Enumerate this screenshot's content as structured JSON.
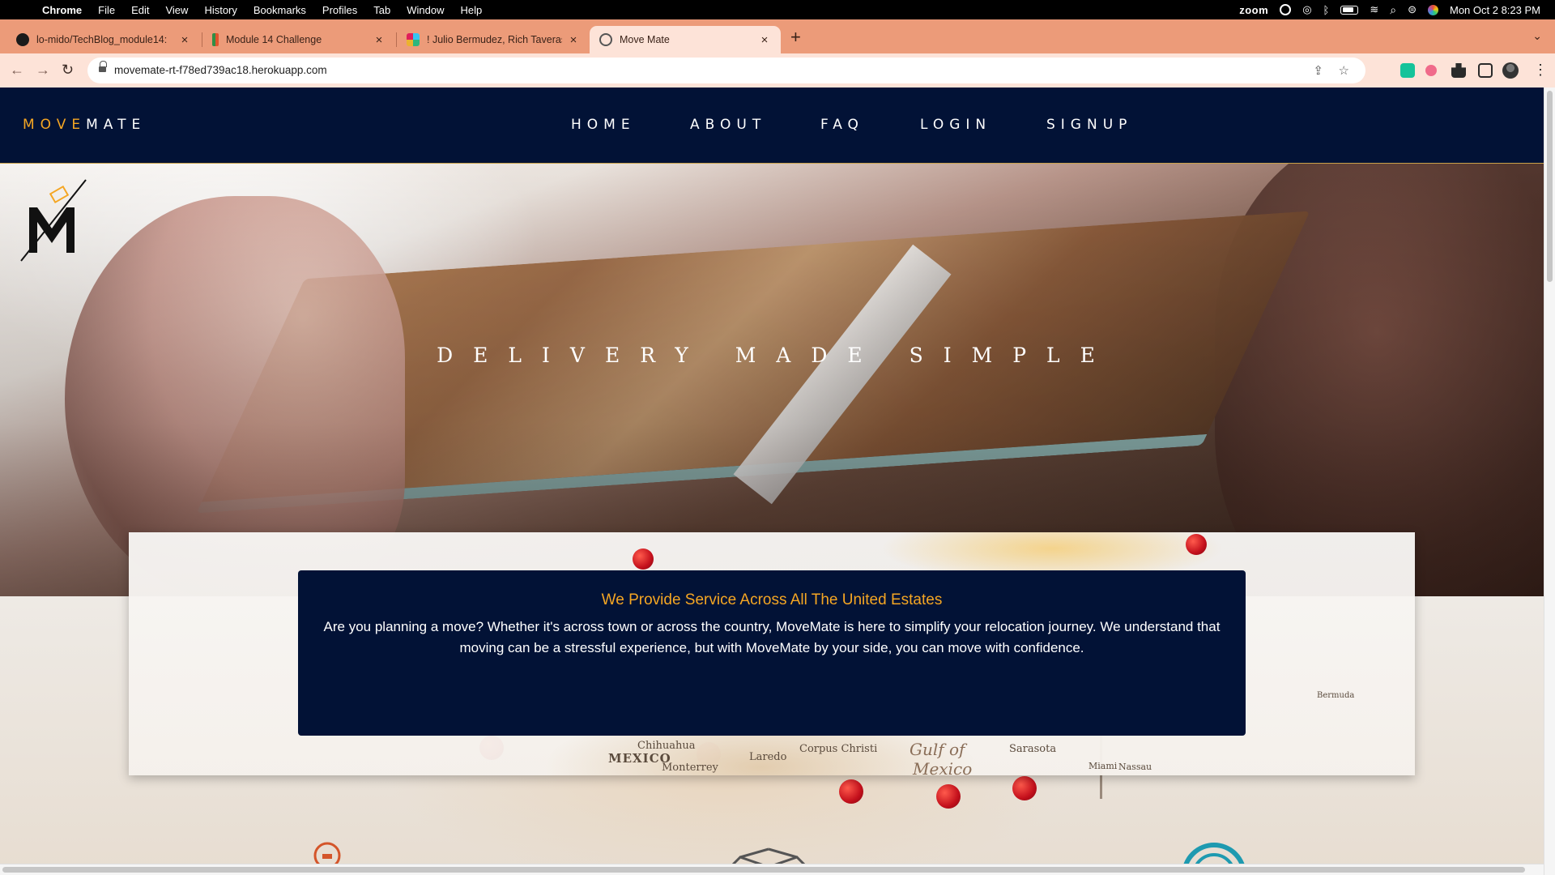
{
  "menubar": {
    "app": "Chrome",
    "items": [
      "File",
      "Edit",
      "View",
      "History",
      "Bookmarks",
      "Profiles",
      "Tab",
      "Window",
      "Help"
    ],
    "zoom_label": "zoom",
    "datetime": "Mon Oct 2  8:23 PM"
  },
  "tabs": [
    {
      "title": "lo-mido/TechBlog_module14:",
      "icon": "github-icon"
    },
    {
      "title": "Module 14 Challenge",
      "icon": "module-icon"
    },
    {
      "title": "! Julio Bermudez, Rich Taveras",
      "icon": "slack-icon"
    },
    {
      "title": "Move Mate",
      "icon": "globe-icon",
      "active": true
    }
  ],
  "toolbar": {
    "url": "movemate-rt-f78ed739ac18.herokuapp.com"
  },
  "site": {
    "brand_part1": "MOVE",
    "brand_part2": "MATE",
    "nav": [
      "HOME",
      "ABOUT",
      "FAQ",
      "LOGIN",
      "SIGNUP"
    ],
    "tagline": "DELIVERY MADE SIMPLE",
    "info_title": "We Provide Service Across All The United Estates",
    "info_body": "Are you planning a move? Whether it's across town or across the country, MoveMate is here to simplify your relocation journey. We understand that moving can be a stressful experience, but with MoveMate by your side, you can move with confidence.",
    "map_labels": {
      "mexico": "MEXICO",
      "chihuahua": "Chihuahua",
      "monterrey": "Monterrey",
      "laredo": "Laredo",
      "corpus": "Corpus Christi",
      "gulf": "Gulf of",
      "mexico2": "Mexico",
      "sarasota": "Sarasota",
      "miami": "Miami",
      "nassau": "Nassau",
      "bermuda": "Bermuda"
    }
  },
  "colors": {
    "nav_bg": "#021236",
    "accent": "#f5a623",
    "tab_strip": "#ec9b79"
  }
}
